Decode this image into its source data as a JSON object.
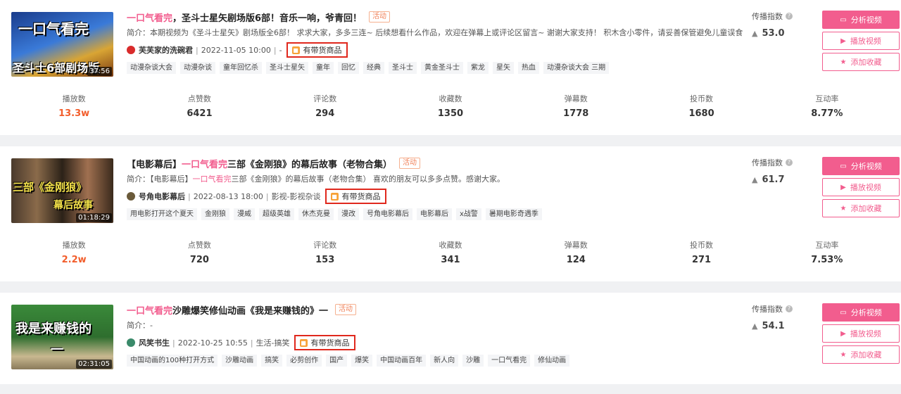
{
  "colors": {
    "accent": "#f25d8e",
    "highlight_box": "#e0281d",
    "play_count": "#f25d2b"
  },
  "labels": {
    "spread_index": "传播指数",
    "analyze": "分析视频",
    "play": "播放视频",
    "favorite": "添加收藏",
    "goods": "有带货商品",
    "activity": "活动",
    "stats": [
      "播放数",
      "点赞数",
      "评论数",
      "收藏数",
      "弹幕数",
      "投币数",
      "互动率"
    ]
  },
  "icons": {
    "analyze": "tv-icon",
    "play": "play-icon",
    "favorite": "star-icon",
    "spread": "flame-icon",
    "info": "question-icon",
    "goods": "shopping-bag-icon"
  },
  "videos": [
    {
      "title_hl": "一口气看完",
      "title_rest": "，圣斗士星矢剧场版6部！音乐一响，爷青回！",
      "title_pre": "",
      "intro": "简介：本期视频为《圣斗士星矢》剧场版全6部！ 求求大家，多多三连~ 后续想看什么作品，欢迎在弹幕上或评论区留言~ 谢谢大家支持！ 积木含小零件，请妥善保管避免儿童误食",
      "intro_pre": "",
      "intro_hl": "",
      "author": "芙芙家的洗碗君",
      "date": "2022-11-05 10:00",
      "category": "-",
      "duration": "37:56",
      "thumb_line1": "一口气看完",
      "thumb_line2": "圣斗士6部剧场版",
      "tags": [
        "动漫杂谈大会",
        "动漫杂谈",
        "童年回忆杀",
        "圣斗士星矢",
        "童年",
        "回忆",
        "经典",
        "圣斗士",
        "黄金圣斗士",
        "紫龙",
        "星矢",
        "热血",
        "动漫杂谈大会 三期"
      ],
      "spread": "53.0",
      "stats": [
        "13.3w",
        "6421",
        "294",
        "1350",
        "1778",
        "1680",
        "8.77%"
      ]
    },
    {
      "title_pre": "【电影幕后】",
      "title_hl": "一口气看完",
      "title_rest": "三部《金刚狼》的幕后故事（老物合集）",
      "intro_pre": "简介：【电影幕后】",
      "intro_hl": "一口气看完",
      "intro": "三部《金刚狼》的幕后故事（老物合集） 喜欢的朋友可以多多点赞。感谢大家。",
      "author": "号角电影幕后",
      "date": "2022-08-13 18:00",
      "category": "影视-影视杂谈",
      "duration": "01:18:29",
      "thumb_line1": "三部《金刚狼》",
      "thumb_line2": "幕后故事",
      "tags": [
        "用电影打开这个夏天",
        "金刚狼",
        "漫威",
        "超级英雄",
        "休杰克曼",
        "漫改",
        "号角电影幕后",
        "电影幕后",
        "x战警",
        "暑期电影奇遇季"
      ],
      "spread": "61.7",
      "stats": [
        "2.2w",
        "720",
        "153",
        "341",
        "124",
        "271",
        "7.53%"
      ]
    },
    {
      "title_pre": "",
      "title_hl": "一口气看完",
      "title_rest": "沙雕爆笑修仙动画《我是来赚钱的》一",
      "intro_pre": "",
      "intro_hl": "",
      "intro": "简介：-",
      "author": "风笑书生",
      "date": "2022-10-25 10:55",
      "category": "生活-搞笑",
      "duration": "02:31:05",
      "thumb_line1": "我是来赚钱的",
      "thumb_line2": "一",
      "tags": [
        "中国动画的100种打开方式",
        "沙雕动画",
        "搞笑",
        "必剪创作",
        "国产",
        "爆笑",
        "中国动画百年",
        "新人向",
        "沙雕",
        "一口气看完",
        "修仙动画"
      ],
      "spread": "54.1",
      "stats": [
        "",
        "",
        "",
        "",
        "",
        "",
        ""
      ]
    }
  ]
}
